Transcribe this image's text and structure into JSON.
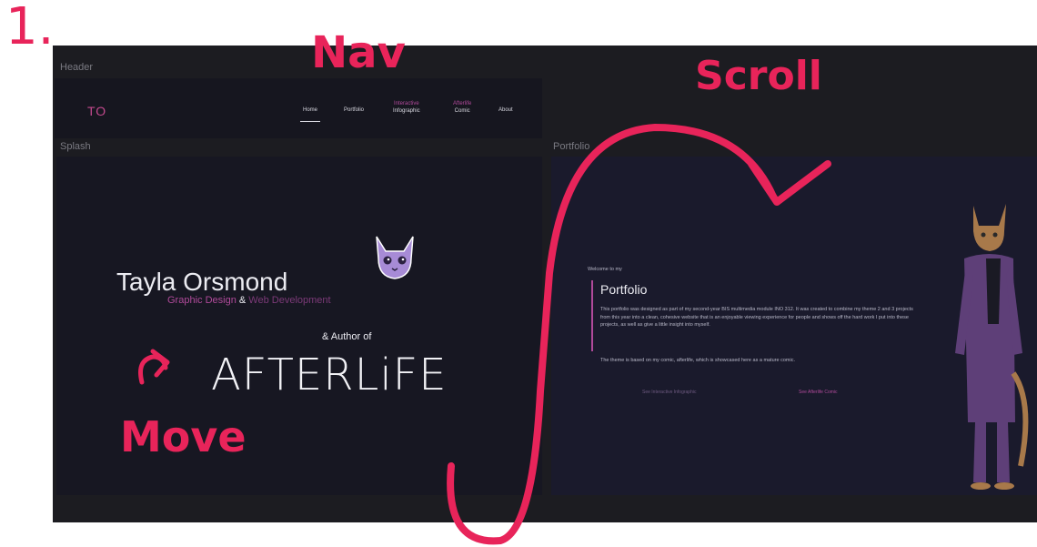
{
  "annotations": {
    "step": "1.",
    "nav": "Nav",
    "scroll": "Scroll",
    "move": "Move"
  },
  "sections": {
    "header": "Header",
    "splash": "Splash",
    "portfolio": "Portfolio"
  },
  "header": {
    "logo": "TO",
    "nav": [
      {
        "label": "Home",
        "sublabel": ""
      },
      {
        "label": "Portfolio",
        "sublabel": ""
      },
      {
        "label": "Infographic",
        "sublabel": "Interactive"
      },
      {
        "label": "Comic",
        "sublabel": "Afterlife"
      },
      {
        "label": "About",
        "sublabel": ""
      }
    ]
  },
  "splash": {
    "name": "Tayla Orsmond",
    "tagline_part1": "Graphic Design",
    "tagline_amp": "&",
    "tagline_part2": "Web Development",
    "author_of": "& Author of",
    "book_title": "AFTERLiFE"
  },
  "portfolio": {
    "welcome": "Welcome to my",
    "title": "Portfolio",
    "body1": "This portfolio was designed as part of my second-year BIS multimedia module INO 312. It was created to combine my theme 2 and 3 projects from this year into a clean, cohesive website that is an enjoyable viewing experience for people and shows off the hard work I put into these projects, as well as give a little insight into myself.",
    "body2": "The theme is based on my comic, afterlife, which is showcased here as a mature comic.",
    "button1": "See Interactive Infographic",
    "button2": "See Afterlife Comic"
  },
  "colors": {
    "annotation": "#e8245a",
    "accent": "#b04a9a",
    "lavender": "#a78bd6",
    "background": "#1c1c21"
  }
}
